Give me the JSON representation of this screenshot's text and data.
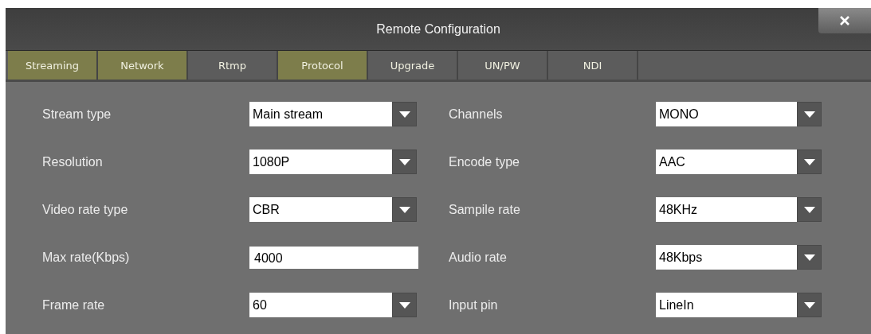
{
  "window": {
    "title": "Remote Configuration"
  },
  "tabs": [
    {
      "label": "Streaming",
      "highlighted": true
    },
    {
      "label": "Network",
      "highlighted": true
    },
    {
      "label": "Rtmp",
      "highlighted": false
    },
    {
      "label": "Protocol",
      "highlighted": true
    },
    {
      "label": "Upgrade",
      "highlighted": false
    },
    {
      "label": "UN/PW",
      "highlighted": false
    },
    {
      "label": "NDI",
      "highlighted": false
    }
  ],
  "columns": [
    [
      {
        "label": "Stream type",
        "kind": "select",
        "value": "Main stream"
      },
      {
        "label": "Resolution",
        "kind": "select",
        "value": "1080P"
      },
      {
        "label": "Video rate type",
        "kind": "select",
        "value": "CBR"
      },
      {
        "label": "Max rate(Kbps)",
        "kind": "input",
        "value": "4000"
      },
      {
        "label": "Frame rate",
        "kind": "select",
        "value": "60"
      }
    ],
    [
      {
        "label": "Channels",
        "kind": "select",
        "value": "MONO"
      },
      {
        "label": "Encode type",
        "kind": "select",
        "value": "AAC"
      },
      {
        "label": "Sampile rate",
        "kind": "select",
        "value": "48KHz"
      },
      {
        "label": "Audio rate",
        "kind": "select",
        "value": "48Kbps"
      },
      {
        "label": "Input pin",
        "kind": "select",
        "value": "LineIn"
      }
    ]
  ]
}
